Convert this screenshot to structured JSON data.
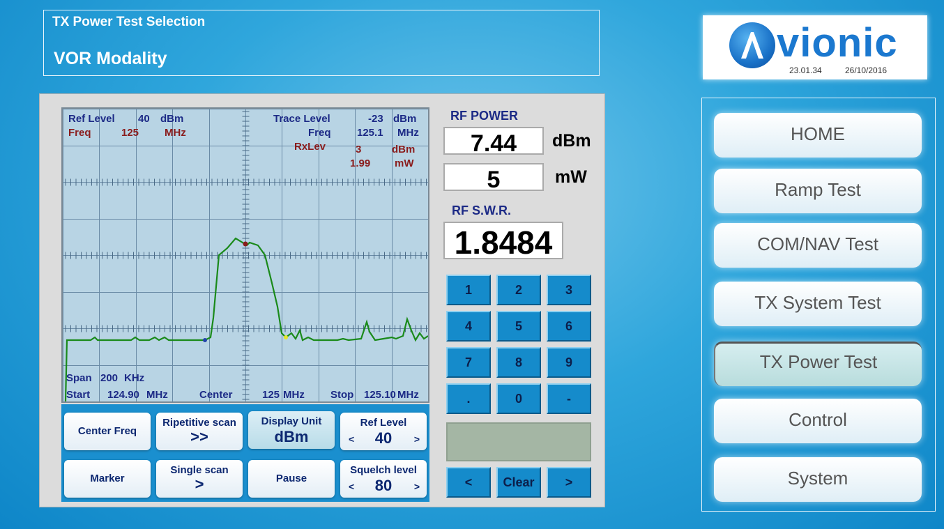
{
  "header": {
    "selection_title": "TX Power Test Selection",
    "modality": "VOR Modality"
  },
  "logo": {
    "brand": "vionic",
    "time": "23.01.34",
    "date": "26/10/2016"
  },
  "spectrum": {
    "ref_level_label": "Ref Level",
    "ref_level_value": "40",
    "ref_level_unit": "dBm",
    "freq_label": "Freq",
    "freq_value": "125",
    "freq_unit": "MHz",
    "trace_level_label": "Trace Level",
    "trace_level_value": "-23",
    "trace_level_unit": "dBm",
    "trace_freq_label": "Freq",
    "trace_freq_value": "125.1",
    "trace_freq_unit": "MHz",
    "rxlev_label": "RxLev",
    "rxlev_value": "3",
    "rxlev_unit": "dBm",
    "rxlev_mw_value": "1.99",
    "rxlev_mw_unit": "mW",
    "span_label": "Span",
    "span_value": "200",
    "span_unit": "KHz",
    "start_label": "Start",
    "start_value": "124.90",
    "start_unit": "MHz",
    "center_label": "Center",
    "center_value": "125",
    "center_unit": "MHz",
    "stop_label": "Stop",
    "stop_value": "125.10",
    "stop_unit": "MHz"
  },
  "softkeys": {
    "center_freq": "Center Freq",
    "ripetitive_scan": "Ripetitive scan",
    "ripetitive_scan_symbol": ">>",
    "display_unit": "Display Unit",
    "display_unit_value": "dBm",
    "ref_level": "Ref Level",
    "ref_level_value": "40",
    "marker": "Marker",
    "single_scan": "Single scan",
    "single_scan_symbol": ">",
    "pause": "Pause",
    "squelch_level": "Squelch level",
    "squelch_level_value": "80",
    "arrow_left": "<",
    "arrow_right": ">"
  },
  "readings": {
    "rf_power_label": "RF POWER",
    "rf_power_dbm": "7.44",
    "dbm_unit": "dBm",
    "rf_power_mw": "5",
    "mw_unit": "mW",
    "swr_label": "RF S.W.R.",
    "swr_value": "1.8484"
  },
  "keypad": {
    "keys": [
      "1",
      "2",
      "3",
      "4",
      "5",
      "6",
      "7",
      "8",
      "9",
      ".",
      "0",
      "-"
    ],
    "left": "<",
    "clear": "Clear",
    "right": ">"
  },
  "nav": {
    "items": [
      "HOME",
      "Ramp Test",
      "COM/NAV Test",
      "TX System Test",
      "TX Power Test",
      "Control",
      "System"
    ],
    "active": "TX Power Test"
  },
  "colors": {
    "trace": "#1a8a1a",
    "accent": "#1a8fcf",
    "label_navy": "#1c2a86",
    "label_maroon": "#8a1c1c"
  }
}
